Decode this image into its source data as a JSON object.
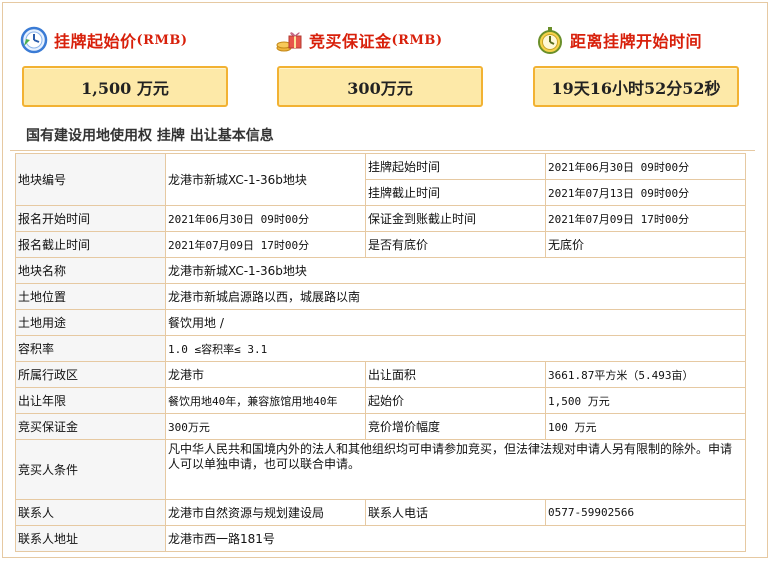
{
  "stats": {
    "start_price": {
      "icon": "clock-icon",
      "label": "挂牌起始价",
      "unit": "(RMB)",
      "value": "1,500 万元"
    },
    "deposit": {
      "icon": "gift-coins-icon",
      "label": "竞买保证金",
      "unit": "(RMB)",
      "value": "300万元"
    },
    "countdown": {
      "icon": "stopwatch-icon",
      "label": "距离挂牌开始时间",
      "value": "19天16小时52分52秒"
    }
  },
  "section_title": "国有建设用地使用权 挂牌 出让基本信息",
  "table": {
    "parcel_no": {
      "label": "地块编号",
      "value": "龙港市新城XC-1-36b地块"
    },
    "listing_start": {
      "label": "挂牌起始时间",
      "value": "2021年06月30日 09时00分"
    },
    "listing_end": {
      "label": "挂牌截止时间",
      "value": "2021年07月13日 09时00分"
    },
    "reg_start": {
      "label": "报名开始时间",
      "value": "2021年06月30日 09时00分"
    },
    "deposit_deadline": {
      "label": "保证金到账截止时间",
      "value": "2021年07月09日 17时00分"
    },
    "reg_end": {
      "label": "报名截止时间",
      "value": "2021年07月09日 17时00分"
    },
    "reserve": {
      "label": "是否有底价",
      "value": "无底价"
    },
    "parcel_name": {
      "label": "地块名称",
      "value": "龙港市新城XC-1-36b地块"
    },
    "location": {
      "label": "土地位置",
      "value": "龙港市新城启源路以西，城展路以南"
    },
    "usage": {
      "label": "土地用途",
      "value": "餐饮用地 /"
    },
    "far": {
      "label": "容积率",
      "value": "1.0 ≤容积率≤ 3.1"
    },
    "district": {
      "label": "所属行政区",
      "value": "龙港市"
    },
    "area": {
      "label": "出让面积",
      "value": "3661.87平方米（5.493亩）"
    },
    "term": {
      "label": "出让年限",
      "value": "餐饮用地40年，兼容旅馆用地40年"
    },
    "start_price": {
      "label": "起始价",
      "value": "1,500 万元"
    },
    "deposit": {
      "label": "竞买保证金",
      "value": "300万元"
    },
    "increment": {
      "label": "竞价增价幅度",
      "value": "100 万元"
    },
    "conditions": {
      "label": "竞买人条件",
      "value": "凡中华人民共和国境内外的法人和其他组织均可申请参加竞买，但法律法规对申请人另有限制的除外。申请人可以单独申请，也可以联合申请。"
    },
    "contact": {
      "label": "联系人",
      "value": "龙港市自然资源与规划建设局"
    },
    "phone": {
      "label": "联系人电话",
      "value": "0577-59902566"
    },
    "address": {
      "label": "联系人地址",
      "value": "龙港市西一路181号"
    }
  },
  "colors": {
    "accent_red": "#d8200b",
    "box_fill": "#fde9a8",
    "box_border": "#f2b233",
    "table_border": "#e6c9a2"
  }
}
